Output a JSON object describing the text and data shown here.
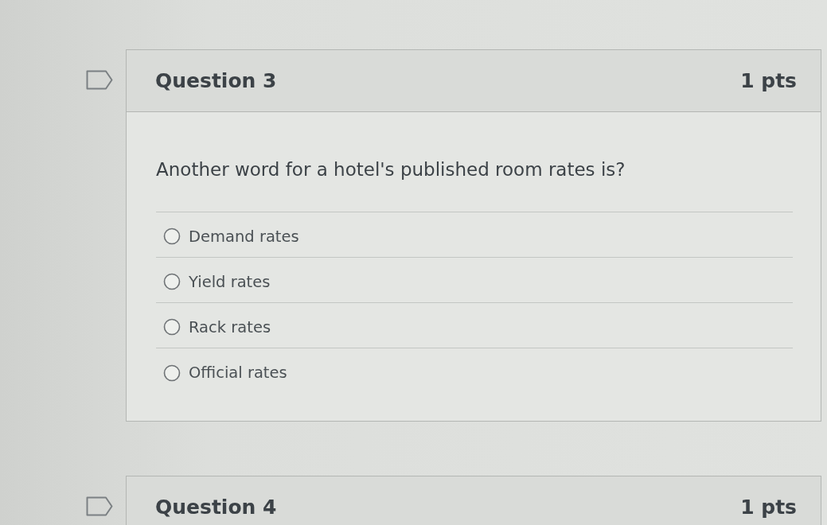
{
  "questions": [
    {
      "flagged": false,
      "title": "Question 3",
      "points": "1 pts",
      "text": "Another word for a hotel's published room rates is?",
      "answers": [
        {
          "label": "Demand rates",
          "selected": false
        },
        {
          "label": "Yield rates",
          "selected": false
        },
        {
          "label": "Rack rates",
          "selected": false
        },
        {
          "label": "Official rates",
          "selected": false
        }
      ]
    },
    {
      "flagged": false,
      "title": "Question 4",
      "points": "1 pts"
    }
  ]
}
